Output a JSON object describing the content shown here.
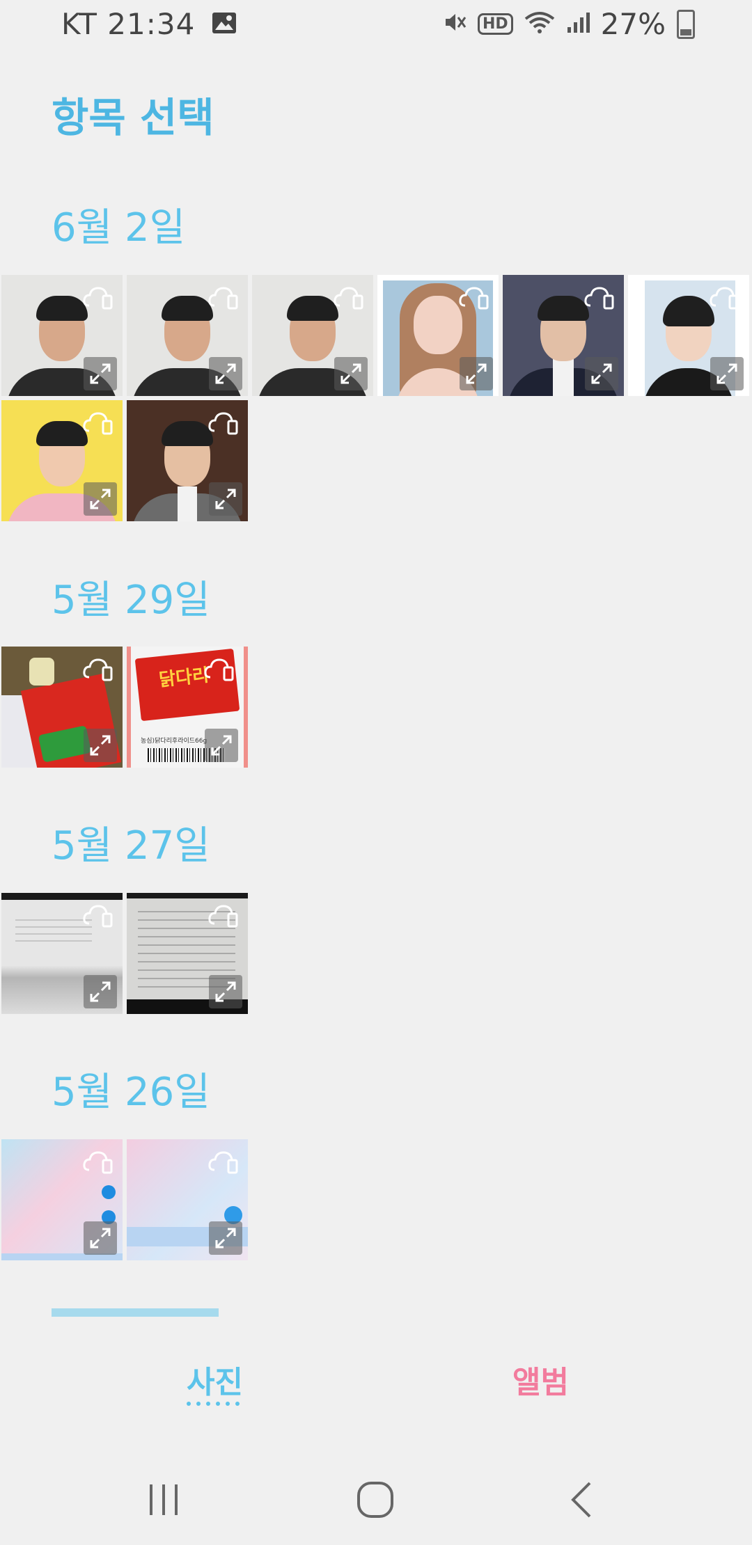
{
  "status": {
    "carrier_time": "KT 21:34",
    "battery": "27%"
  },
  "title": "항목 선택",
  "sections": [
    {
      "date": "6월 2일",
      "count": 8
    },
    {
      "date": "5월 29일",
      "count": 2
    },
    {
      "date": "5월 27일",
      "count": 2
    },
    {
      "date": "5월 26일",
      "count": 2
    }
  ],
  "tabs": {
    "photos": "사진",
    "albums": "앨범"
  },
  "colors": {
    "accent_blue": "#5cc3ea",
    "accent_pink": "#f27b9d",
    "background": "#f0f0f0"
  },
  "thumbnails": {
    "snack_box_caption": "농심)닭다리후라이드66g",
    "snack_box_title": "닭다리"
  }
}
